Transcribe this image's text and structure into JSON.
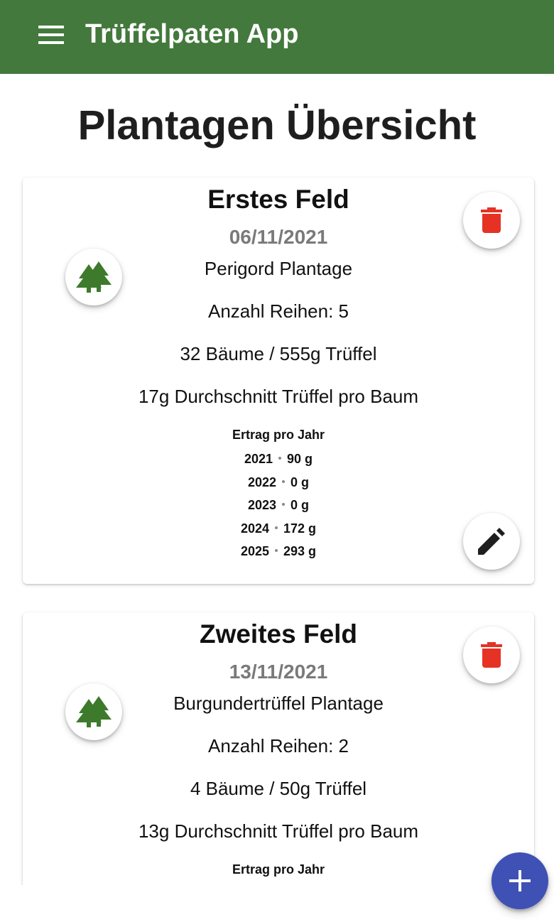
{
  "appbar": {
    "title": "Trüffelpaten App",
    "menu_icon": "menu-icon",
    "color": "#43793c"
  },
  "page": {
    "title": "Plantagen Übersicht"
  },
  "plantations": [
    {
      "name": "Erstes Feld",
      "date": "06/11/2021",
      "type": "Perigord Plantage",
      "rows": "Anzahl Reihen: 5",
      "totals": "32 Bäume / 555g Trüffel",
      "average": "17g Durchschnitt Trüffel pro Baum",
      "yield_title": "Ertrag pro Jahr",
      "yields": [
        {
          "year": "2021",
          "amount": "90 g"
        },
        {
          "year": "2022",
          "amount": "0 g"
        },
        {
          "year": "2023",
          "amount": "0 g"
        },
        {
          "year": "2024",
          "amount": "172 g"
        },
        {
          "year": "2025",
          "amount": "293 g"
        }
      ]
    },
    {
      "name": "Zweites Feld",
      "date": "13/11/2021",
      "type": "Burgundertrüffel Plantage",
      "rows": "Anzahl Reihen: 2",
      "totals": "4 Bäume / 50g Trüffel",
      "average": "13g Durchschnitt Trüffel pro Baum",
      "yield_title": "Ertrag pro Jahr",
      "yields": []
    }
  ],
  "icons": {
    "tree": "trees-icon",
    "delete": "trash-icon",
    "edit": "pencil-icon",
    "add": "plus-icon"
  },
  "colors": {
    "tree": "#3d7a2c",
    "delete": "#e53225",
    "edit": "#1f1f1f",
    "add_fab": "#3f51b5",
    "date_text": "#7a7a7a"
  }
}
